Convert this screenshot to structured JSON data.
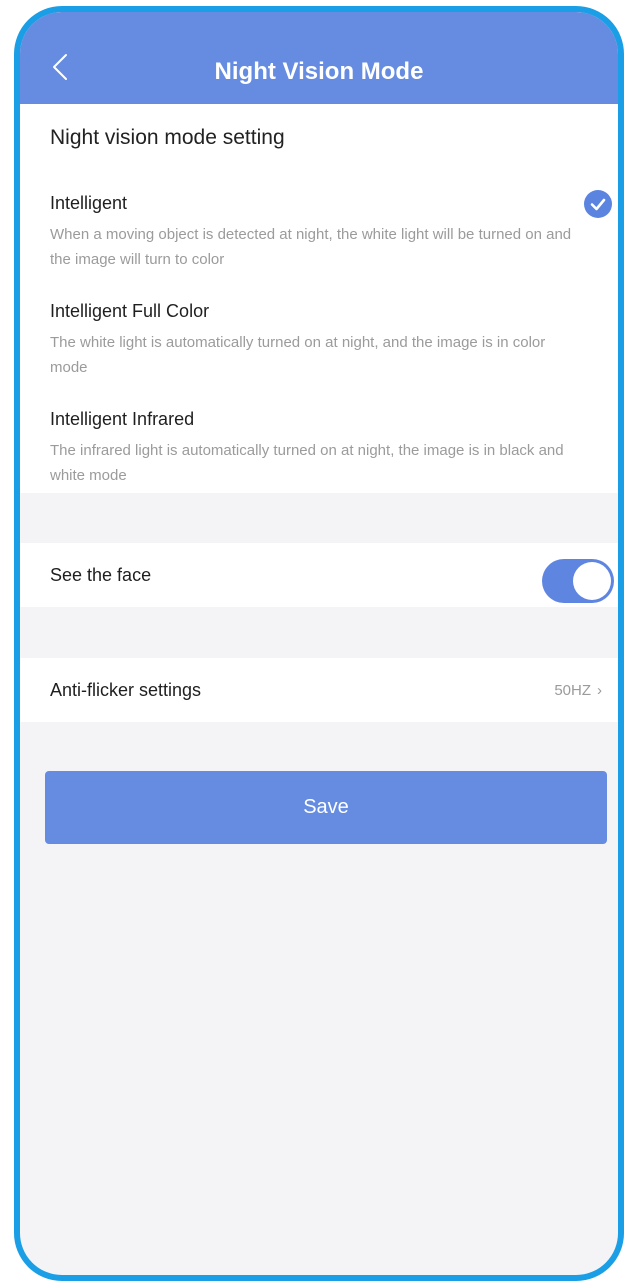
{
  "header": {
    "title": "Night Vision Mode"
  },
  "night_vision": {
    "section_title": "Night vision mode setting",
    "modes": [
      {
        "name": "Intelligent",
        "description": "When a moving object is detected at night, the white light will be turned on and the image will turn to color",
        "selected": true
      },
      {
        "name": "Intelligent Full Color",
        "description": "The white light is automatically turned on at night, and the image is in color mode",
        "selected": false
      },
      {
        "name": "Intelligent Infrared",
        "description": "The infrared light is automatically turned on at night, the image is in black and white mode",
        "selected": false
      }
    ]
  },
  "see_face": {
    "label": "See the face",
    "enabled": true
  },
  "anti_flicker": {
    "label": "Anti-flicker settings",
    "value": "50HZ"
  },
  "save": {
    "label": "Save"
  },
  "colors": {
    "accent": "#658ce0",
    "frame": "#1a9ee6",
    "background": "#f4f4f6"
  }
}
